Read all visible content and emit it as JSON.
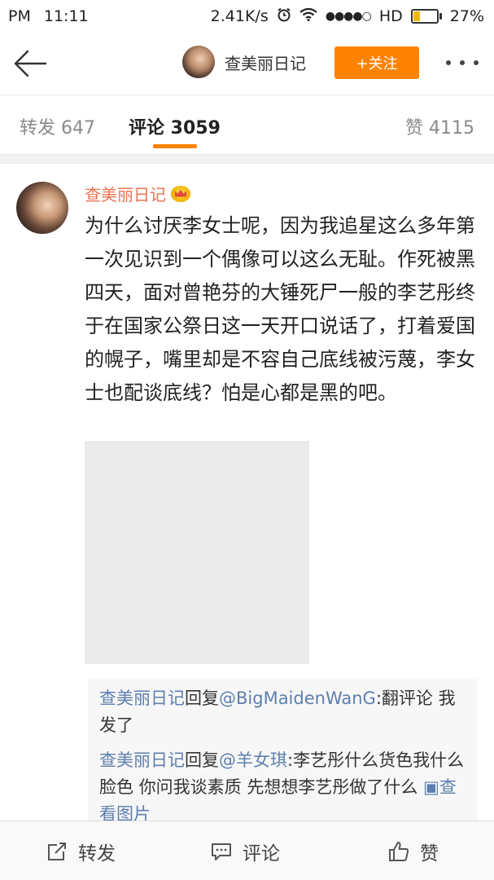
{
  "status_bar": {
    "period": "PM",
    "time": "11:11",
    "speed": "2.41K/s",
    "network": "HD",
    "battery": "27%",
    "battery_level": 0.27
  },
  "nav": {
    "title": "查美丽日记",
    "follow_label": "+关注",
    "colors": {
      "accent": "#ff8200"
    }
  },
  "tabs": {
    "repost": "转发 647",
    "comment": "评论 3059",
    "like": "赞 4115"
  },
  "comment": {
    "author": "查美丽日记",
    "text": "为什么讨厌李女士呢，因为我追星这么多年第一次见识到一个偶像可以这么无耻。作死被黑四天，面对曾艳芬的大锤死尸一般的李艺彤终于在国家公祭日这一天开口说话了，打着爱国的幌子，嘴里却是不容自己底线被污蔑，李女士也配谈底线？怕是心都是黑的吧。"
  },
  "replies": [
    {
      "user": "查美丽日记",
      "verb": "回复",
      "mention": "@BigMaidenWanG",
      "text": ":翻评论 我发了"
    },
    {
      "user": "查美丽日记",
      "verb": "回复",
      "mention": "@羊女琪",
      "text": ":李艺彤什么货色我什么脸色 你问我谈素质 先想想李艺彤做了什么",
      "link": "查看图片"
    }
  ],
  "toolbar": {
    "repost": "转发",
    "comment": "评论",
    "like": "赞"
  },
  "icons": [
    "back-arrow-icon",
    "alarm-icon",
    "wifi-icon",
    "signal-icon",
    "battery-icon",
    "more-icon",
    "crown-badge-icon",
    "repost-icon",
    "comment-icon",
    "like-icon",
    "image-link-icon"
  ]
}
